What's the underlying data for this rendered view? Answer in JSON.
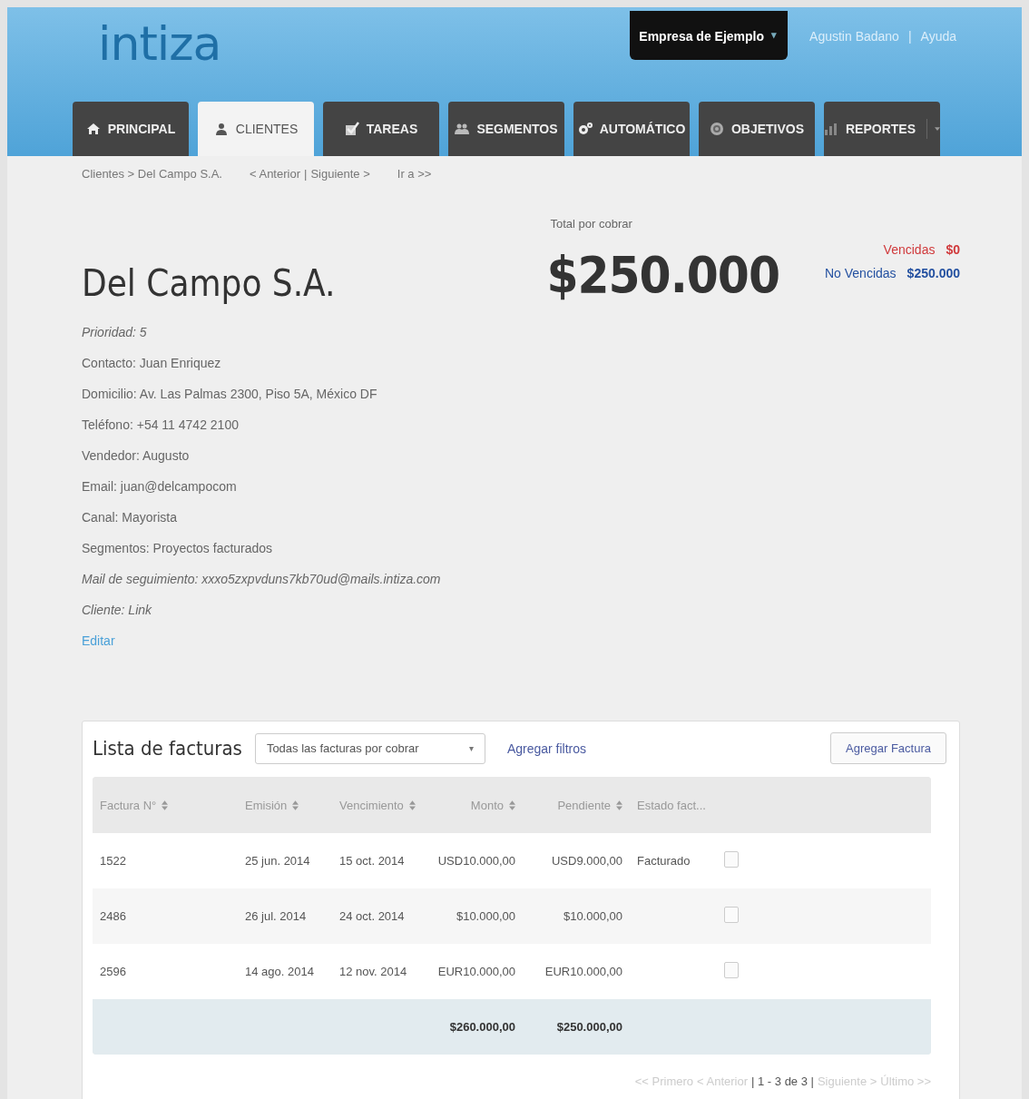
{
  "header": {
    "logo": "intiza",
    "company_menu": {
      "label": "Empresa de Ejemplo",
      "caret": "▾"
    },
    "user_links": [
      "Agustin Badano",
      "Ayuda"
    ],
    "user_separator": "|"
  },
  "tabs": [
    {
      "label": "PRINCIPAL",
      "selected": false
    },
    {
      "label": "CLIENTES",
      "selected": true
    },
    {
      "label": "TAREAS",
      "selected": false
    },
    {
      "label": "SEGMENTOS",
      "selected": false
    },
    {
      "label": "AUTOMÁTICO",
      "selected": false
    },
    {
      "label": "OBJETIVOS",
      "selected": false
    },
    {
      "label": "REPORTES",
      "selected": false,
      "menu": true
    }
  ],
  "breadcrumb": {
    "path": "Clientes > Del Campo S.A.",
    "previous": "< Anterior",
    "separator": "|",
    "next": "Siguiente >",
    "goto": "Ir a >>"
  },
  "client": {
    "name": "Del Campo S.A.",
    "fields": [
      {
        "text": "Prioridad: 5",
        "italic": true
      },
      {
        "text": "Contacto: Juan Enriquez",
        "italic": false
      },
      {
        "text": "Domicilio: Av. Las Palmas 2300, Piso 5A, México DF",
        "italic": false
      },
      {
        "text": "Teléfono: +54 11 4742 2100",
        "italic": false
      },
      {
        "text": "Vendedor: Augusto",
        "italic": false
      },
      {
        "text": "Email: juan@delcampocom",
        "italic": false
      },
      {
        "text": "Canal: Mayorista",
        "italic": false
      },
      {
        "text": "Segmentos: Proyectos facturados",
        "italic": false
      },
      {
        "text": "Mail de seguimiento: xxxo5zxpvduns7kb70ud@mails.intiza.com",
        "italic": true
      },
      {
        "text": "Cliente: Link",
        "italic": true
      }
    ],
    "edit_link": "Editar"
  },
  "totals": {
    "label": "Total por cobrar",
    "amount": "$250.000",
    "breakdown": [
      {
        "label": "Vencidas",
        "value": "$0",
        "color": "#d0393b"
      },
      {
        "label": "No Vencidas",
        "value": "$250.000",
        "color": "#2350a0"
      }
    ]
  },
  "invoices": {
    "title": "Lista de facturas",
    "filter": {
      "value": "Todas las facturas por cobrar",
      "caret": "▾"
    },
    "add_filters": "Agregar filtros",
    "add_button": "Agregar Factura",
    "columns": [
      {
        "label": "Factura N°",
        "sortable": true
      },
      {
        "label": "Emisión",
        "sortable": true
      },
      {
        "label": "Vencimiento",
        "sortable": true
      },
      {
        "label": "Monto",
        "sortable": true
      },
      {
        "label": "Pendiente",
        "sortable": true
      },
      {
        "label": "Estado fact...",
        "sortable": false
      }
    ],
    "rows": [
      {
        "cells": [
          "1522",
          "25 jun. 2014",
          "15 oct. 2014",
          "USD10.000,00",
          "USD9.000,00",
          "Facturado"
        ],
        "checked": false
      },
      {
        "cells": [
          "2486",
          "26 jul. 2014",
          "24 oct. 2014",
          "$10.000,00",
          "$10.000,00"
        ],
        "checked": false
      },
      {
        "cells": [
          "2596",
          "14 ago. 2014",
          "12 nov. 2014",
          "EUR10.000,00",
          "EUR10.000,00"
        ],
        "checked": false
      }
    ],
    "totals": {
      "amount": "$260.000,00",
      "pending": "$250.000,00"
    },
    "pagination": [
      {
        "text": "<< Primero",
        "disabled": true
      },
      {
        "text": "< Anterior",
        "disabled": true
      },
      {
        "text": "| 1 - 3 de 3 |",
        "disabled": false
      },
      {
        "text": "Siguiente >",
        "disabled": true
      },
      {
        "text": "Último >>",
        "disabled": true
      }
    ]
  }
}
